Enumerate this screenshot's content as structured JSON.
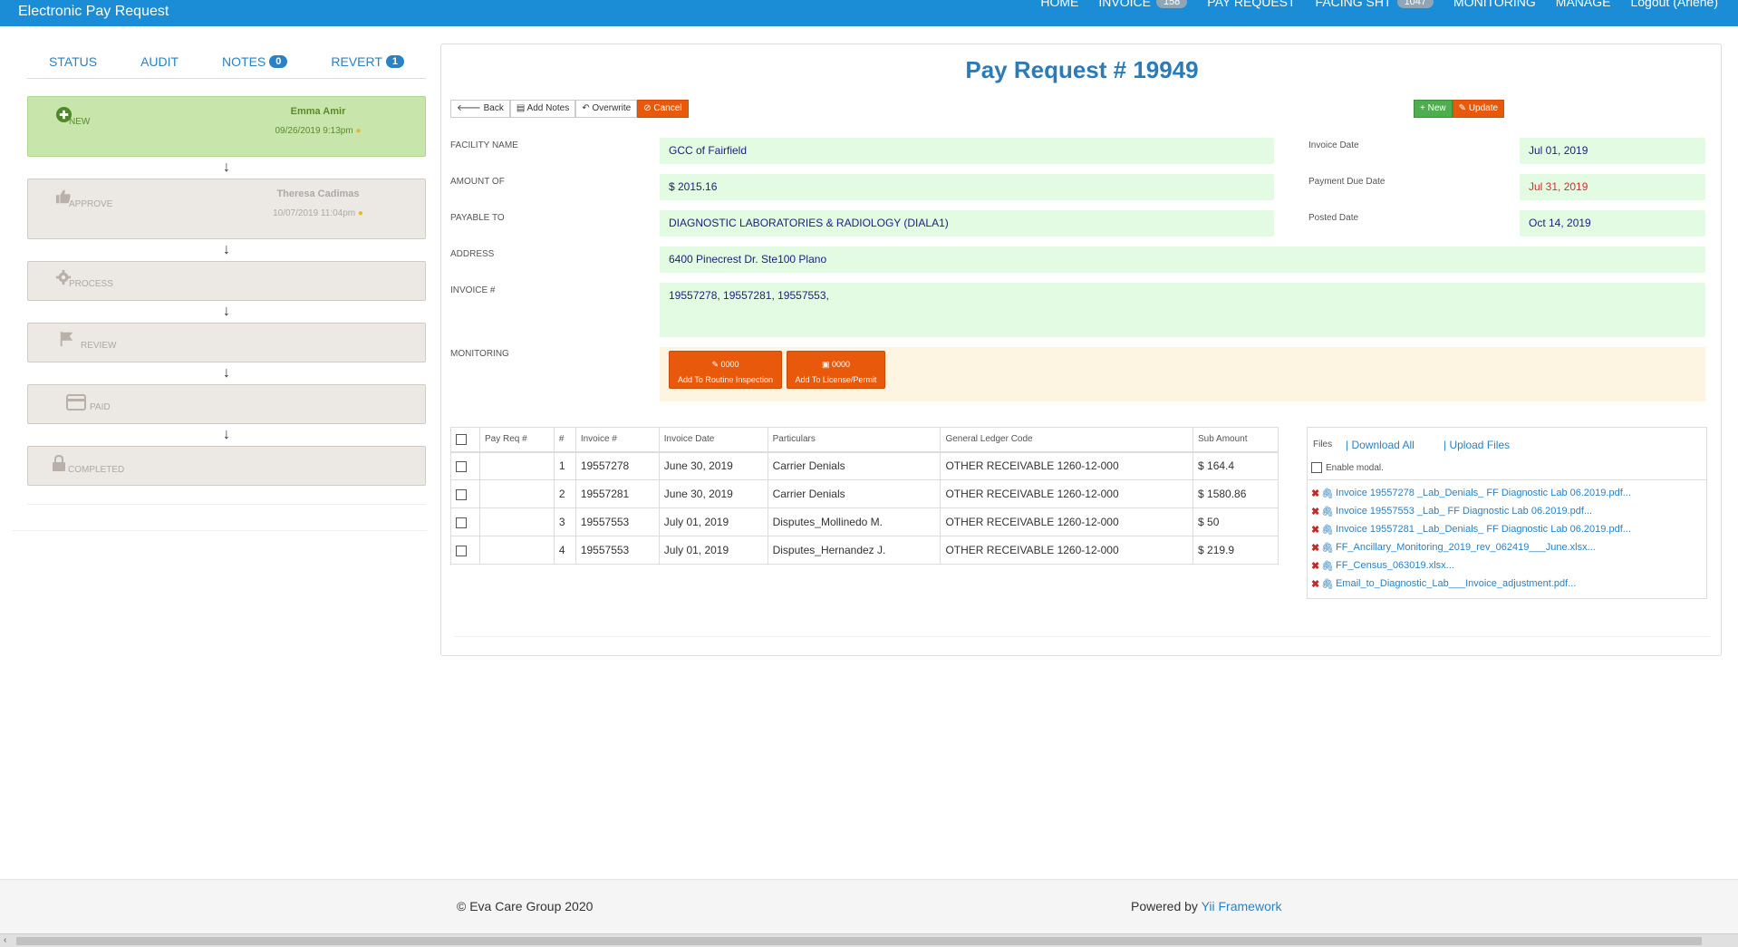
{
  "app": {
    "title": "Electronic Pay Request"
  },
  "nav": {
    "home": "HOME",
    "invoice": "INVOICE",
    "invoice_count": "158",
    "pay_request": "PAY REQUEST",
    "facing_sheet": "FACING SHT",
    "facing_sheet_count": "1047",
    "monitoring": "MONITORING",
    "manage": "MANAGE",
    "logout": "Logout (Arlene)"
  },
  "tabs": {
    "status": "STATUS",
    "audit": "AUDIT",
    "notes": "NOTES",
    "notes_count": "0",
    "revert": "REVERT",
    "revert_count": "1"
  },
  "workflow": {
    "new": {
      "label": "NEW",
      "user": "Emma Amir",
      "date": "09/26/2019 9:13pm"
    },
    "approve": {
      "label": "APPROVE",
      "user": "Theresa Cadimas",
      "date": "10/07/2019 11:04pm"
    },
    "process": {
      "label": "PROCESS"
    },
    "review": {
      "label": "REVIEW"
    },
    "paid": {
      "label": "PAID"
    },
    "completed": {
      "label": "COMPLETED"
    }
  },
  "page": {
    "title": "Pay Request # 19949"
  },
  "toolbar": {
    "back": "Back",
    "add_notes": "Add Notes",
    "overwrite": "Overwrite",
    "cancel": "Cancel",
    "new": "New",
    "update": "Update"
  },
  "form": {
    "facility_label": "FACILITY NAME",
    "facility": "GCC of Fairfield",
    "amount_label": "AMOUNT OF",
    "amount": "$ 2015.16",
    "payable_label": "PAYABLE TO",
    "payable": "DIAGNOSTIC LABORATORIES & RADIOLOGY (DIALA1)",
    "address_label": "ADDRESS",
    "address": "6400 Pinecrest Dr. Ste100 Plano",
    "invoice_label": "INVOICE #",
    "invoice": "19557278, 19557281, 19557553,",
    "monitoring_label": "MONITORING",
    "invoice_date_label": "Invoice Date",
    "invoice_date": "Jul 01, 2019",
    "due_date_label": "Payment Due Date",
    "due_date": "Jul 31, 2019",
    "posted_date_label": "Posted Date",
    "posted_date": "Oct 14, 2019"
  },
  "monitoring": {
    "routine_code": "0000",
    "routine_label": "Add To Routine Inspection",
    "license_code": "0000",
    "license_label": "Add To License/Permit"
  },
  "table": {
    "headers": [
      "Pay Req #",
      "#",
      "Invoice #",
      "Invoice Date",
      "Particulars",
      "General Ledger Code",
      "Sub Amount"
    ],
    "rows": [
      {
        "payreq": "",
        "num": "1",
        "invoice": "19557278",
        "date": "June 30, 2019",
        "particulars": "Carrier Denials",
        "gl": "OTHER RECEIVABLE 1260-12-000",
        "amount": "$ 164.4"
      },
      {
        "payreq": "",
        "num": "2",
        "invoice": "19557281",
        "date": "June 30, 2019",
        "particulars": "Carrier Denials",
        "gl": "OTHER RECEIVABLE 1260-12-000",
        "amount": "$ 1580.86"
      },
      {
        "payreq": "",
        "num": "3",
        "invoice": "19557553",
        "date": "July 01, 2019",
        "particulars": "Disputes_Mollinedo M.",
        "gl": "OTHER RECEIVABLE 1260-12-000",
        "amount": "$ 50"
      },
      {
        "payreq": "",
        "num": "4",
        "invoice": "19557553",
        "date": "July 01, 2019",
        "particulars": "Disputes_Hernandez J.",
        "gl": "OTHER RECEIVABLE 1260-12-000",
        "amount": "$ 219.9"
      }
    ]
  },
  "files": {
    "title": "Files",
    "download_all": "| Download All",
    "upload": "| Upload Files",
    "enable_modal": "Enable modal.",
    "items": [
      "Invoice 19557278 _Lab_Denials_ FF Diagnostic Lab 06.2019.pdf...",
      "Invoice 19557553 _Lab_ FF Diagnostic Lab 06.2019.pdf...",
      "Invoice 19557281 _Lab_Denials_ FF Diagnostic Lab 06.2019.pdf...",
      "FF_Ancillary_Monitoring_2019_rev_062419___June.xlsx...",
      "FF_Census_063019.xlsx...",
      "Email_to_Diagnostic_Lab___Invoice_adjustment.pdf..."
    ]
  },
  "footer": {
    "copyright": "© Eva Care Group 2020",
    "powered": "Powered by",
    "framework": "Yii Framework"
  },
  "colors": {
    "navbar": "#1b8dd6",
    "accent": "#2b7bb9",
    "field_bg": "#e3fbe3",
    "danger": "#e8590c",
    "new_stage": "#c8e6ab"
  }
}
